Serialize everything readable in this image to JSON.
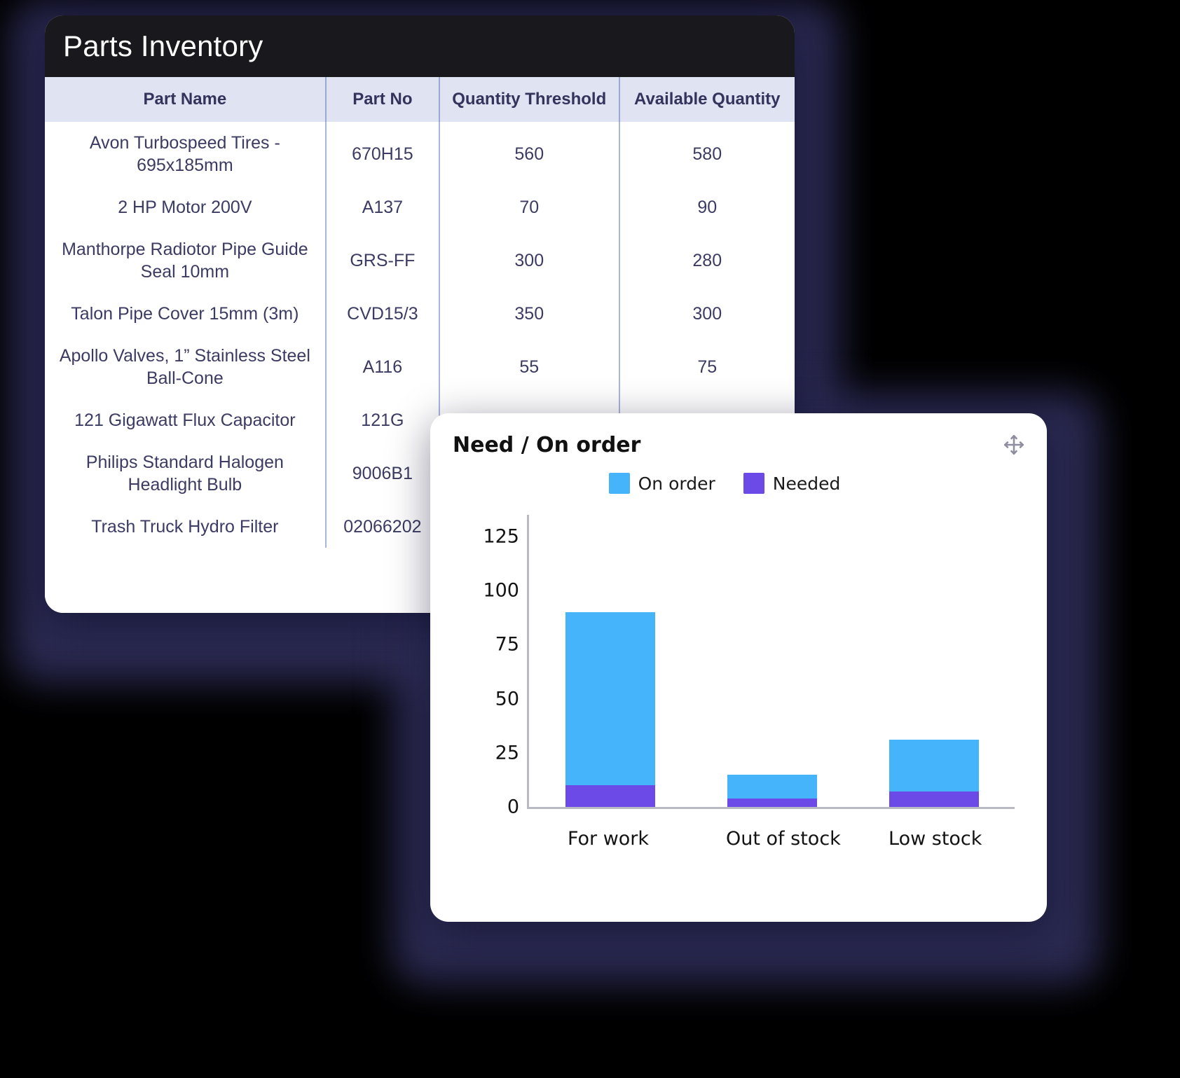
{
  "table_card": {
    "title": "Parts Inventory",
    "columns": [
      "Part Name",
      "Part No",
      "Quantity Threshold",
      "Available Quantity"
    ],
    "rows": [
      {
        "part_name": "Avon Turbospeed Tires - 695x185mm",
        "part_no": "670H15",
        "threshold": "560",
        "available": "580"
      },
      {
        "part_name": "2 HP Motor 200V",
        "part_no": "A137",
        "threshold": "70",
        "available": "90"
      },
      {
        "part_name": "Manthorpe Radiotor Pipe Guide Seal 10mm",
        "part_no": "GRS-FF",
        "threshold": "300",
        "available": "280"
      },
      {
        "part_name": "Talon Pipe Cover 15mm (3m)",
        "part_no": "CVD15/3",
        "threshold": "350",
        "available": "300"
      },
      {
        "part_name": "Apollo Valves, 1” Stainless Steel Ball-Cone",
        "part_no": "A116",
        "threshold": "55",
        "available": "75"
      },
      {
        "part_name": "121 Gigawatt Flux Capacitor",
        "part_no": "121G",
        "threshold": "",
        "available": ""
      },
      {
        "part_name": "Philips Standard Halogen Headlight Bulb",
        "part_no": "9006B1",
        "threshold": "",
        "available": ""
      },
      {
        "part_name": "Trash Truck Hydro Filter",
        "part_no": "02066202",
        "threshold": "",
        "available": ""
      }
    ]
  },
  "chart_card": {
    "title": "Need / On order",
    "move_icon": "move-arrows-icon"
  },
  "colors": {
    "on_order": "#46b4fa",
    "needed": "#6b4ae8",
    "header_bar": "#19191d",
    "table_head": "#dfe3f2",
    "text_indigo": "#3b3b63"
  },
  "chart_data": {
    "type": "bar",
    "stacked": true,
    "title": "Need / On order",
    "xlabel": "",
    "ylabel": "",
    "categories": [
      "For work",
      "Out of stock",
      "Low stock"
    ],
    "series": [
      {
        "name": "Needed",
        "color": "#6b4ae8",
        "values": [
          10,
          4,
          7
        ]
      },
      {
        "name": "On order",
        "color": "#46b4fa",
        "values": [
          80,
          11,
          24
        ]
      }
    ],
    "stack_totals": [
      90,
      15,
      31
    ],
    "yticks": [
      0,
      25,
      50,
      75,
      100,
      125
    ],
    "ylim": [
      0,
      135
    ],
    "grid": false,
    "legend": {
      "position": "top-right",
      "entries": [
        "On order",
        "Needed"
      ]
    }
  }
}
